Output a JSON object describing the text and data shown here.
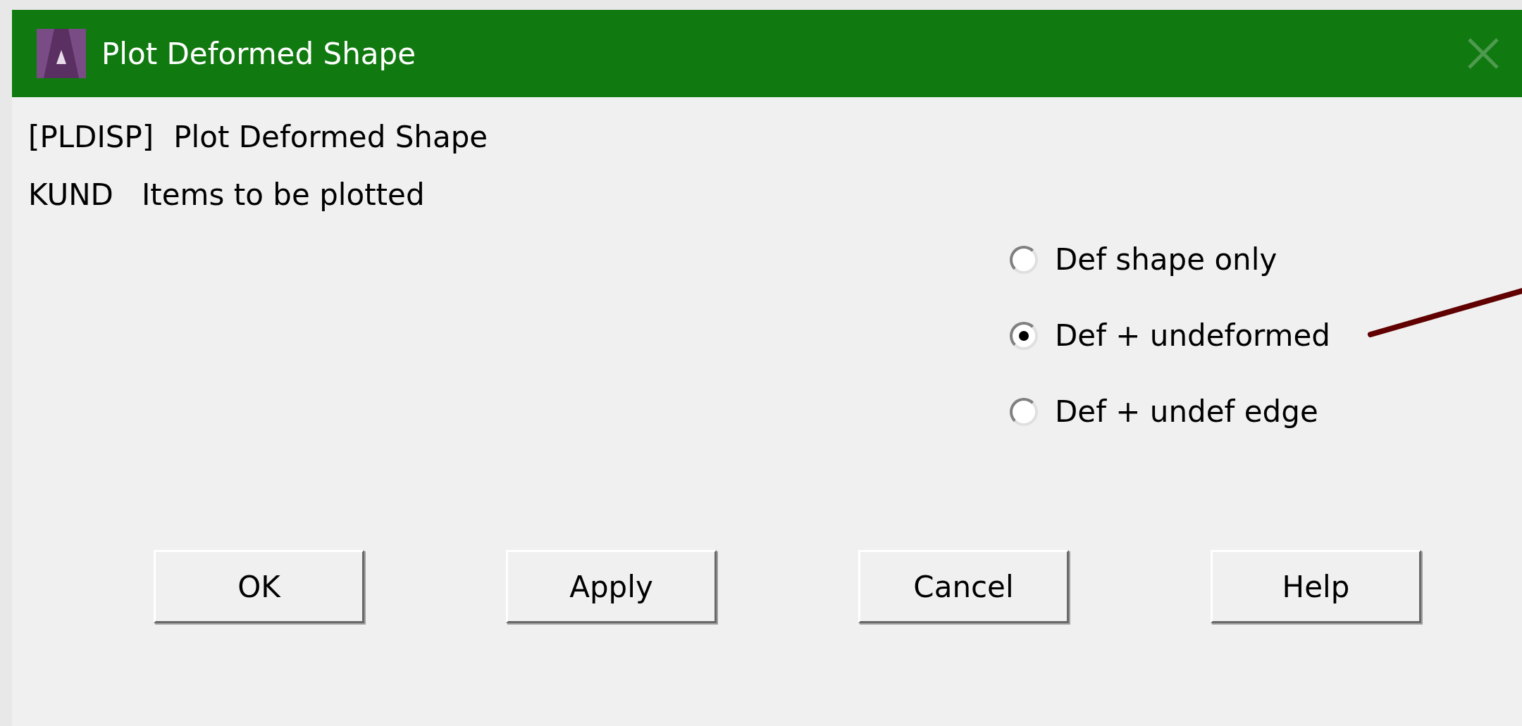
{
  "window": {
    "title": "Plot Deformed Shape"
  },
  "command": {
    "code": "[PLDISP]",
    "title": "Plot Deformed Shape"
  },
  "field": {
    "name": "KUND",
    "label": "Items to be plotted"
  },
  "options": [
    {
      "label": "Def shape only",
      "selected": false
    },
    {
      "label": "Def + undeformed",
      "selected": true
    },
    {
      "label": "Def + undef edge",
      "selected": false
    }
  ],
  "buttons": [
    "OK",
    "Apply",
    "Cancel",
    "Help"
  ]
}
